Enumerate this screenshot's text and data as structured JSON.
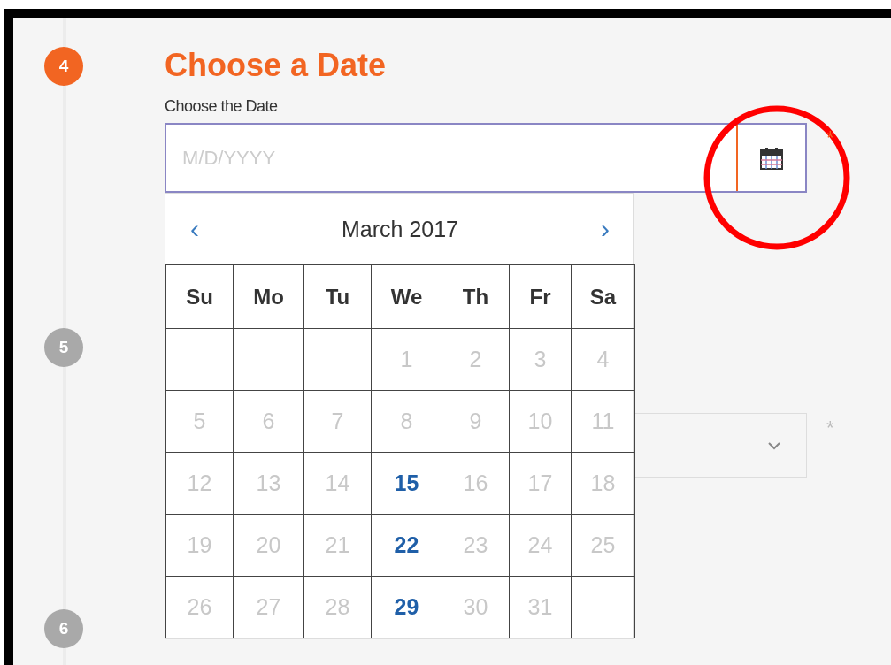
{
  "steps": [
    {
      "number": "4",
      "active": true
    },
    {
      "number": "5",
      "active": false
    },
    {
      "number": "6",
      "active": false
    }
  ],
  "section": {
    "title": "Choose a Date",
    "field_label": "Choose the Date",
    "placeholder": "M/D/YYYY",
    "required_mark": "*"
  },
  "calendar": {
    "prev": "‹",
    "next": "›",
    "month": "March 2017",
    "weekdays": [
      "Su",
      "Mo",
      "Tu",
      "We",
      "Th",
      "Fr",
      "Sa"
    ],
    "weeks": [
      [
        {
          "kind": "empty"
        },
        {
          "kind": "empty"
        },
        {
          "kind": "empty"
        },
        {
          "kind": "day",
          "day": "1",
          "available": false
        },
        {
          "kind": "day",
          "day": "2",
          "available": false
        },
        {
          "kind": "day",
          "day": "3",
          "available": false
        },
        {
          "kind": "day",
          "day": "4",
          "available": false
        }
      ],
      [
        {
          "kind": "day",
          "day": "5",
          "available": false
        },
        {
          "kind": "day",
          "day": "6",
          "available": false
        },
        {
          "kind": "day",
          "day": "7",
          "available": false
        },
        {
          "kind": "day",
          "day": "8",
          "available": false
        },
        {
          "kind": "day",
          "day": "9",
          "available": false
        },
        {
          "kind": "day",
          "day": "10",
          "available": false
        },
        {
          "kind": "day",
          "day": "11",
          "available": false
        }
      ],
      [
        {
          "kind": "day",
          "day": "12",
          "available": false
        },
        {
          "kind": "day",
          "day": "13",
          "available": false
        },
        {
          "kind": "day",
          "day": "14",
          "available": false
        },
        {
          "kind": "day",
          "day": "15",
          "available": true
        },
        {
          "kind": "day",
          "day": "16",
          "available": false
        },
        {
          "kind": "day",
          "day": "17",
          "available": false
        },
        {
          "kind": "day",
          "day": "18",
          "available": false
        }
      ],
      [
        {
          "kind": "day",
          "day": "19",
          "available": false
        },
        {
          "kind": "day",
          "day": "20",
          "available": false
        },
        {
          "kind": "day",
          "day": "21",
          "available": false
        },
        {
          "kind": "day",
          "day": "22",
          "available": true
        },
        {
          "kind": "day",
          "day": "23",
          "available": false
        },
        {
          "kind": "day",
          "day": "24",
          "available": false
        },
        {
          "kind": "day",
          "day": "25",
          "available": false
        }
      ],
      [
        {
          "kind": "day",
          "day": "26",
          "available": false
        },
        {
          "kind": "day",
          "day": "27",
          "available": false
        },
        {
          "kind": "day",
          "day": "28",
          "available": false
        },
        {
          "kind": "day",
          "day": "29",
          "available": true
        },
        {
          "kind": "day",
          "day": "30",
          "available": false
        },
        {
          "kind": "day",
          "day": "31",
          "available": false
        },
        {
          "kind": "empty"
        }
      ]
    ]
  },
  "next_field": {
    "required_mark": "*"
  }
}
